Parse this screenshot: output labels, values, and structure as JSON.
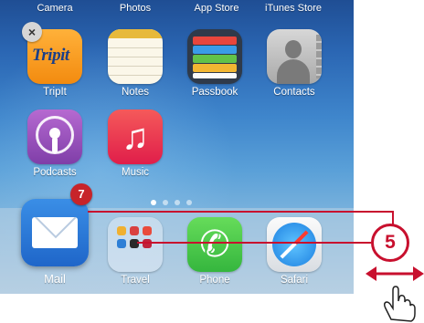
{
  "top_labels": [
    "Camera",
    "Photos",
    "App Store",
    "iTunes Store"
  ],
  "delete_badge": "×",
  "apps": {
    "row1": [
      {
        "label": "TripIt",
        "icon": "tripit-icon",
        "icon_text": "Tripit"
      },
      {
        "label": "Notes",
        "icon": "notes-icon"
      },
      {
        "label": "Passbook",
        "icon": "passbook-icon"
      },
      {
        "label": "Contacts",
        "icon": "contacts-icon"
      }
    ],
    "row2": [
      {
        "label": "Podcasts",
        "icon": "podcasts-icon"
      },
      {
        "label": "Music",
        "icon": "music-icon",
        "glyph": "♫"
      }
    ]
  },
  "page_dots": {
    "count": 4,
    "active": 1
  },
  "dock": {
    "mail": {
      "label": "Mail",
      "badge": "7"
    },
    "travel": {
      "label": "Travel"
    },
    "phone": {
      "label": "Phone",
      "glyph": "✆"
    },
    "safari": {
      "label": "Safari"
    }
  },
  "callout": {
    "step": "5",
    "color": "#c8102e"
  },
  "colors": {
    "callout_red": "#c8102e",
    "badge_red": "#c7242a"
  }
}
